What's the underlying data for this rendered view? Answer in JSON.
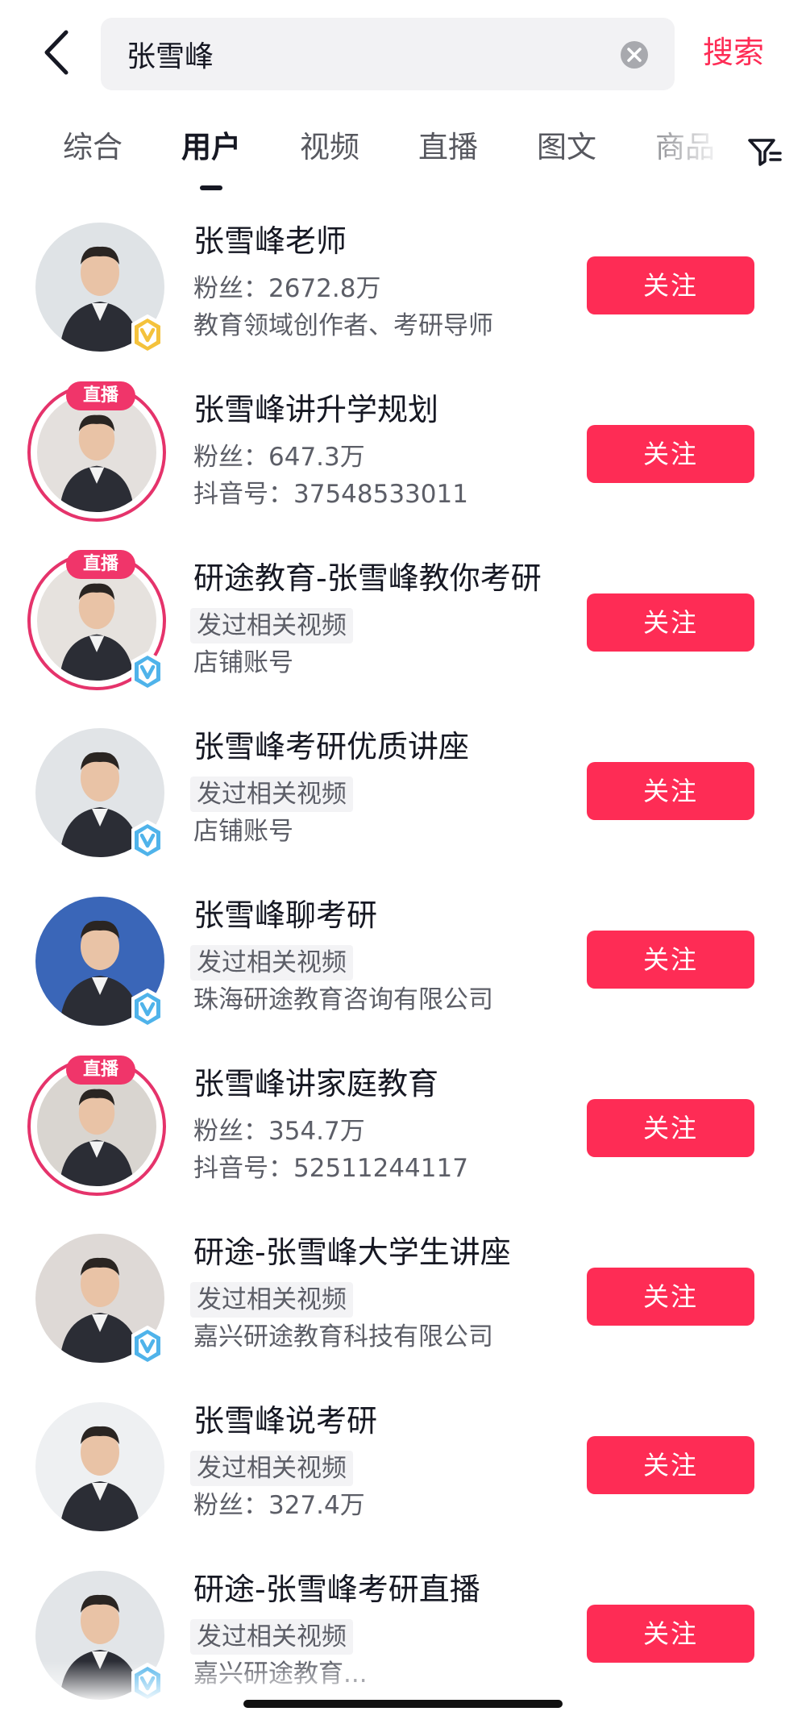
{
  "search": {
    "query": "张雪峰",
    "button_label": "搜索"
  },
  "tabs": [
    {
      "label": "综合",
      "active": false
    },
    {
      "label": "用户",
      "active": true
    },
    {
      "label": "视频",
      "active": false
    },
    {
      "label": "直播",
      "active": false
    },
    {
      "label": "图文",
      "active": false
    },
    {
      "label": "商品",
      "active": false
    }
  ],
  "colors": {
    "accent": "#fe2c55",
    "live_ring": "#e5336b",
    "verify_gold": "#f4c23c",
    "verify_blue": "#4fb3ea"
  },
  "follow_label": "关注",
  "live_label": "直播",
  "users": [
    {
      "name": "张雪峰老师",
      "line2": "粉丝：2672.8万",
      "line2_tag": false,
      "line3": "教育领域创作者、考研导师",
      "live": false,
      "verify": "gold"
    },
    {
      "name": "张雪峰讲升学规划",
      "line2": "粉丝：647.3万",
      "line2_tag": false,
      "line3": "抖音号：37548533011",
      "live": true,
      "verify": "none"
    },
    {
      "name": "研途教育-张雪峰教你考研",
      "line2": "发过相关视频",
      "line2_tag": true,
      "line3": "店铺账号",
      "live": true,
      "verify": "blue"
    },
    {
      "name": "张雪峰考研优质讲座",
      "line2": "发过相关视频",
      "line2_tag": true,
      "line3": "店铺账号",
      "live": false,
      "verify": "blue"
    },
    {
      "name": "张雪峰聊考研",
      "line2": "发过相关视频",
      "line2_tag": true,
      "line3": "珠海研途教育咨询有限公司",
      "live": false,
      "verify": "blue"
    },
    {
      "name": "张雪峰讲家庭教育",
      "line2": "粉丝：354.7万",
      "line2_tag": false,
      "line3": "抖音号：52511244117",
      "live": true,
      "verify": "none"
    },
    {
      "name": "研途-张雪峰大学生讲座",
      "line2": "发过相关视频",
      "line2_tag": true,
      "line3": "嘉兴研途教育科技有限公司",
      "live": false,
      "verify": "blue"
    },
    {
      "name": "张雪峰说考研",
      "line2": "发过相关视频",
      "line2_tag": true,
      "line3": "粉丝：327.4万",
      "live": false,
      "verify": "none"
    },
    {
      "name": "研途-张雪峰考研直播",
      "line2": "发过相关视频",
      "line2_tag": true,
      "line3": "嘉兴研途教育...",
      "live": false,
      "verify": "blue"
    }
  ]
}
